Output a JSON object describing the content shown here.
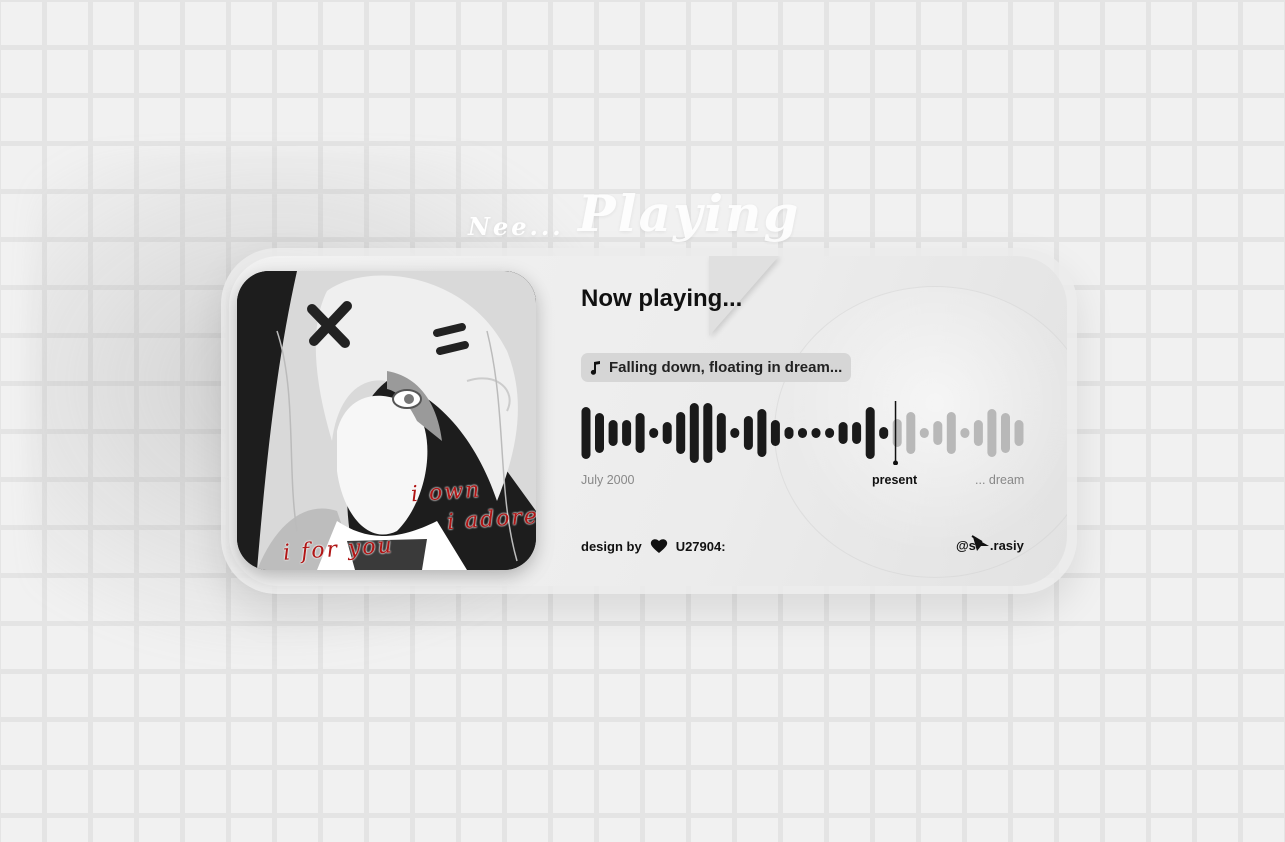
{
  "background": {
    "deco_small": "Nee...",
    "deco_big": "Playing"
  },
  "album": {
    "lyrics": [
      "i own",
      "i adore",
      "i for you"
    ],
    "lyric_color": "#b01515"
  },
  "header": {
    "title": "Now playing..."
  },
  "track": {
    "icon": "music-note-icon",
    "title": "Falling down, floating in dream..."
  },
  "player": {
    "progress": 0.71,
    "start_label": "July 2000",
    "current_label": "present",
    "end_label": "... dream",
    "played_color": "#1a1a1a",
    "unplayed_color": "#b8b8b8"
  },
  "footer": {
    "design_by": "design by",
    "designer": "U27904:",
    "designer_icon": "heart-icon",
    "handle": "@s",
    "handle_tail": ".rasiy"
  }
}
